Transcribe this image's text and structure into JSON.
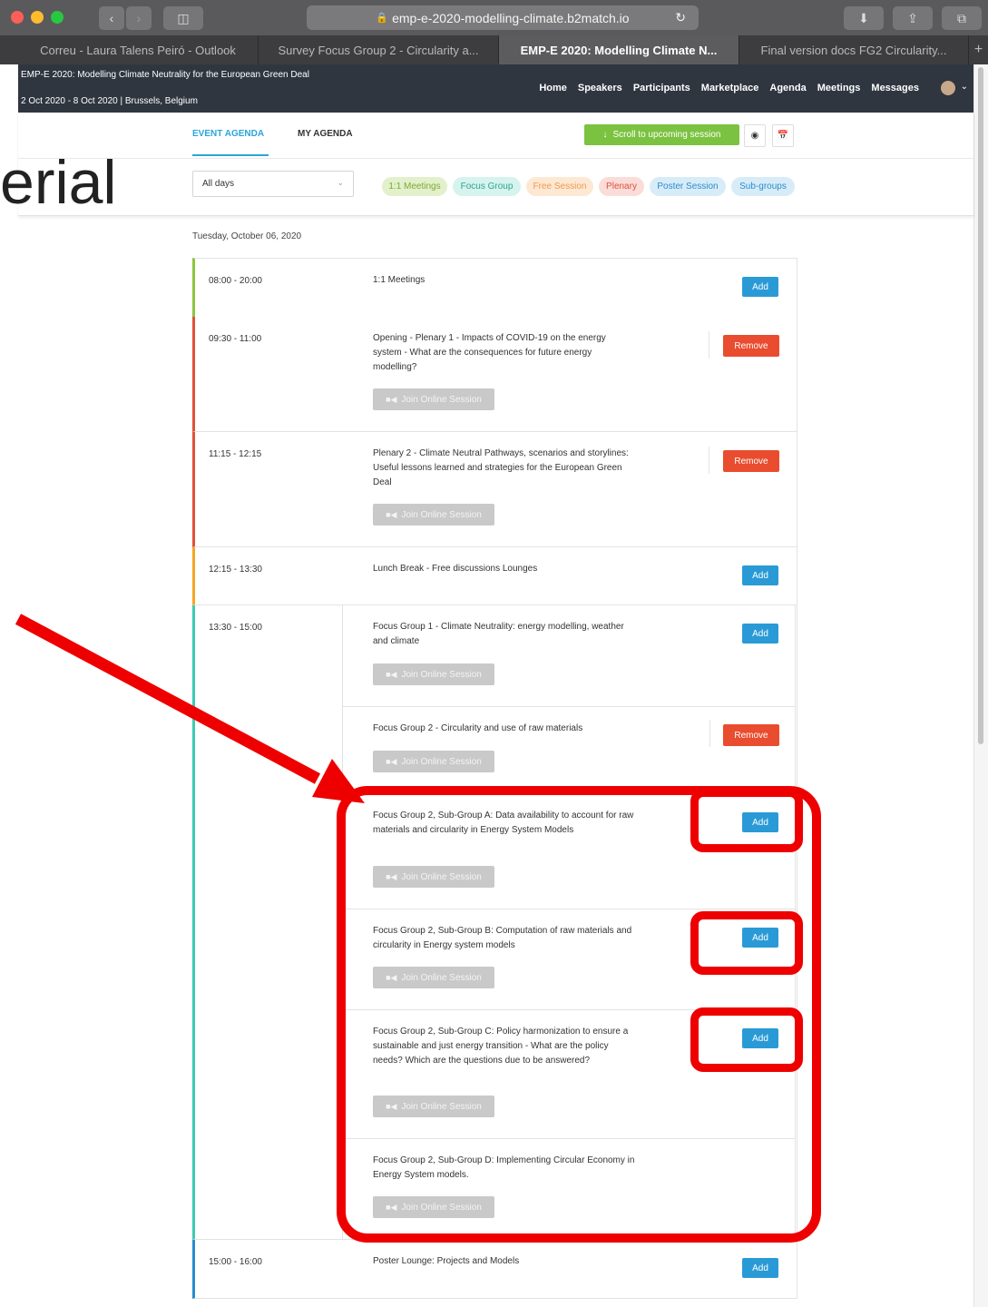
{
  "browser": {
    "url": "emp-e-2020-modelling-climate.b2match.io",
    "tabs": [
      "Correu - Laura Talens Peiró - Outlook",
      "Survey Focus Group 2 - Circularity a...",
      "EMP-E 2020: Modelling Climate N...",
      "Final version docs FG2 Circularity..."
    ],
    "new_tab": "+"
  },
  "site": {
    "title": "EMP-E 2020: Modelling Climate Neutrality for the European Green Deal",
    "dates": "2 Oct 2020 - 8 Oct 2020 | Brussels, Belgium",
    "nav": [
      "Home",
      "Speakers",
      "Participants",
      "Marketplace",
      "Agenda",
      "Meetings",
      "Messages"
    ]
  },
  "agenda_tabs": {
    "event": "EVENT AGENDA",
    "my": "MY AGENDA",
    "scroll_btn": "Scroll to upcoming session"
  },
  "filter": {
    "days": "All days",
    "pills": [
      {
        "label": "1:1 Meetings",
        "bg": "#e3f0cc",
        "fg": "#7aaa2e"
      },
      {
        "label": "Focus Group",
        "bg": "#d6f3ee",
        "fg": "#2aa791"
      },
      {
        "label": "Free Session",
        "bg": "#fde8d4",
        "fg": "#ef9b4a"
      },
      {
        "label": "Plenary",
        "bg": "#fadcd8",
        "fg": "#e0513a"
      },
      {
        "label": "Poster Session",
        "bg": "#d8ecf8",
        "fg": "#2a8ccf"
      },
      {
        "label": "Sub-groups",
        "bg": "#d8ecf8",
        "fg": "#2a8ccf"
      }
    ]
  },
  "overlay_text": "erial",
  "day_label": "Tuesday, October 06, 2020",
  "buttons": {
    "add": "Add",
    "remove": "Remove",
    "join": "Join Online Session"
  },
  "sessions": {
    "s1": {
      "time": "08:00 - 20:00",
      "title": "1:1 Meetings"
    },
    "s2": {
      "time": "09:30 - 11:00",
      "title": "Opening - Plenary 1 - Impacts of COVID-19 on the energy system - What are the consequences for future energy modelling?"
    },
    "s3": {
      "time": "11:15 - 12:15",
      "title": "Plenary 2 - Climate Neutral Pathways, scenarios and storylines: Useful lessons learned and strategies for the European Green Deal"
    },
    "s4": {
      "time": "12:15 - 13:30",
      "title": "Lunch Break - Free discussions Lounges"
    },
    "s5": {
      "time": "13:30 - 15:00"
    },
    "fg1": {
      "title": "Focus Group 1 - Climate Neutrality: energy modelling, weather and climate"
    },
    "fg2": {
      "title": "Focus Group 2 - Circularity and use of raw materials"
    },
    "sga": {
      "title": "Focus Group 2, Sub-Group A: Data availability to account for raw materials and circularity in Energy System Models"
    },
    "sgb": {
      "title": "Focus Group 2, Sub-Group B: Computation of raw materials and circularity in Energy system models"
    },
    "sgc": {
      "title": "Focus Group 2, Sub-Group C: Policy harmonization to ensure a sustainable and just energy transition - What are the policy needs? Which are the questions due to be answered?"
    },
    "sgd": {
      "title": "Focus Group 2, Sub-Group D: Implementing Circular Economy in Energy System models."
    },
    "s6": {
      "time": "15:00 - 16:00",
      "title": "Poster Lounge: Projects and Models"
    }
  },
  "colors": {
    "meetings": "#8cc63f",
    "plenary": "#e0513a",
    "free": "#f5a623",
    "focus": "#3dcbb1",
    "poster": "#2a8ccf",
    "annotation": "#ee0000"
  }
}
